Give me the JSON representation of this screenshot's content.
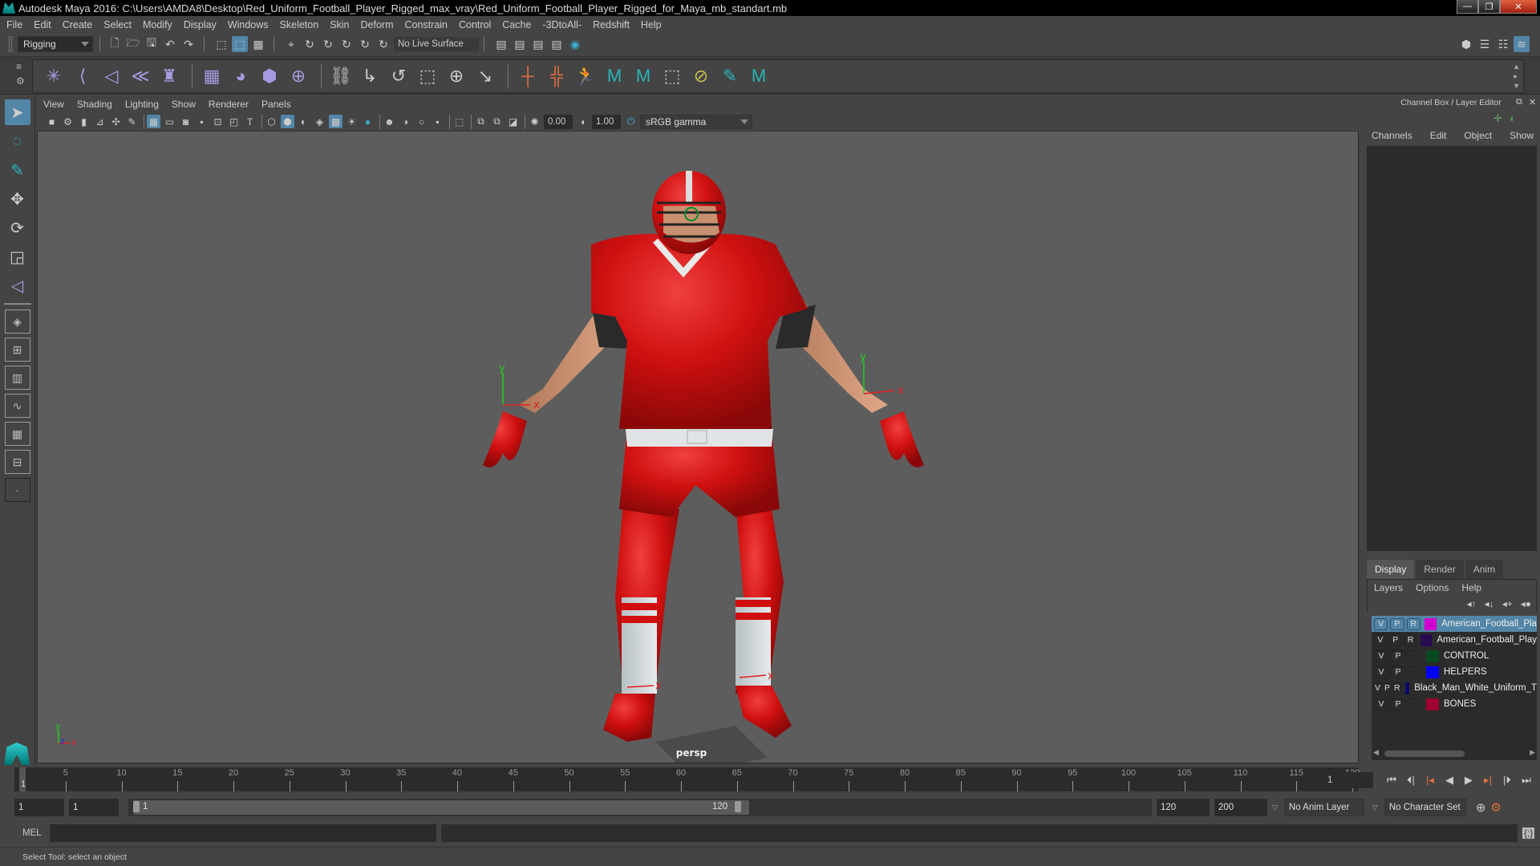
{
  "window": {
    "title": "Autodesk Maya 2016: C:\\Users\\AMDA8\\Desktop\\Red_Uniform_Football_Player_Rigged_max_vray\\Red_Uniform_Football_Player_Rigged_for_Maya_mb_standart.mb",
    "minimize": "—",
    "maximize": "❐",
    "close": "✕"
  },
  "menubar": [
    "File",
    "Edit",
    "Create",
    "Select",
    "Modify",
    "Display",
    "Windows",
    "Skeleton",
    "Skin",
    "Deform",
    "Constrain",
    "Control",
    "Cache",
    "-3DtoAll-",
    "Redshift",
    "Help"
  ],
  "statusline": {
    "menuset": "Rigging",
    "live_surface": "No Live Surface"
  },
  "shelf": {
    "icons": [
      {
        "name": "joint-tool-icon",
        "glyph": "✳",
        "color": "purple"
      },
      {
        "name": "ik-handle-icon",
        "glyph": "⟨",
        "color": "purple"
      },
      {
        "name": "ik-spline-icon",
        "glyph": "◁",
        "color": "purple"
      },
      {
        "name": "insert-joint-icon",
        "glyph": "≪",
        "color": "purple"
      },
      {
        "name": "humanik-icon",
        "glyph": "♜",
        "color": "purple"
      },
      {
        "name": "paint-weights-icon",
        "glyph": "▦",
        "color": "purple"
      },
      {
        "name": "bind-skin-icon",
        "glyph": "◕",
        "color": "purple"
      },
      {
        "name": "lattice-icon",
        "glyph": "⬢",
        "color": "purple"
      },
      {
        "name": "cluster-icon",
        "glyph": "⊕",
        "color": "purple"
      },
      {
        "name": "parent-constraint-icon",
        "glyph": "⛓",
        "color": "grey"
      },
      {
        "name": "point-constraint-icon",
        "glyph": "↳",
        "color": "grey"
      },
      {
        "name": "orient-constraint-icon",
        "glyph": "↺",
        "color": "grey"
      },
      {
        "name": "scale-constraint-icon",
        "glyph": "⬚",
        "color": "grey"
      },
      {
        "name": "aim-constraint-icon",
        "glyph": "⊕",
        "color": "grey"
      },
      {
        "name": "pole-vector-icon",
        "glyph": "↘",
        "color": "grey"
      },
      {
        "name": "set-key-icon",
        "glyph": "┼",
        "color": "orange"
      },
      {
        "name": "set-driven-key-icon",
        "glyph": "╬",
        "color": "orange"
      },
      {
        "name": "character-set-icon",
        "glyph": "🏃",
        "color": "orange"
      },
      {
        "name": "maya-logo-icon",
        "glyph": "M",
        "color": "teal"
      },
      {
        "name": "maya-logo-icon-2",
        "glyph": "M",
        "color": "teal"
      },
      {
        "name": "empty-slot-icon",
        "glyph": "⬚",
        "color": "grey"
      },
      {
        "name": "layers-off-icon",
        "glyph": "⊘",
        "color": "yellow"
      },
      {
        "name": "paint-select-icon",
        "glyph": "✎",
        "color": "teal"
      },
      {
        "name": "maya-logo-icon-3",
        "glyph": "M",
        "color": "teal"
      }
    ]
  },
  "panel": {
    "menus": [
      "View",
      "Shading",
      "Lighting",
      "Show",
      "Renderer",
      "Panels"
    ],
    "exposure": "0.00",
    "gamma": "1.00",
    "color_space": "sRGB gamma",
    "camera_label": "persp",
    "axis_labels": {
      "x": "x",
      "y": "y",
      "z": "z"
    }
  },
  "channel_box": {
    "title": "Channel Box / Layer Editor",
    "menus": [
      "Channels",
      "Edit",
      "Object",
      "Show"
    ]
  },
  "layer_editor": {
    "tabs": [
      "Display",
      "Render",
      "Anim"
    ],
    "active_tab": "Display",
    "menus": [
      "Layers",
      "Options",
      "Help"
    ],
    "layers": [
      {
        "v": "V",
        "p": "P",
        "r": "R",
        "color": "#d000d0",
        "name": "American_Football_Pla",
        "selected": true
      },
      {
        "v": "V",
        "p": "P",
        "r": "R",
        "color": "#2a0a50",
        "name": "American_Football_Play",
        "selected": false
      },
      {
        "v": "V",
        "p": "P",
        "r": "",
        "color": "#0a4a20",
        "name": "CONTROL",
        "selected": false
      },
      {
        "v": "V",
        "p": "P",
        "r": "",
        "color": "#0000ff",
        "name": "HELPERS",
        "selected": false
      },
      {
        "v": "V",
        "p": "P",
        "r": "R",
        "color": "#0a0a6a",
        "name": "Black_Man_White_Uniform_T",
        "selected": false
      },
      {
        "v": "V",
        "p": "P",
        "r": "",
        "color": "#a00030",
        "name": "BONES",
        "selected": false
      }
    ]
  },
  "timeline": {
    "ticks": [
      5,
      10,
      15,
      20,
      25,
      30,
      35,
      40,
      45,
      50,
      55,
      60,
      65,
      70,
      75,
      80,
      85,
      90,
      95,
      100,
      105,
      110,
      115,
      120
    ],
    "start": 1,
    "end": 120,
    "current_frame": "1",
    "current_frame_field": "1"
  },
  "range": {
    "start_field": "1",
    "playback_start": "1",
    "range_start_label": "1",
    "range_end_label": "120",
    "playback_end": "120",
    "end_field": "200",
    "anim_layer": "No Anim Layer",
    "character_set": "No Character Set"
  },
  "command": {
    "language": "MEL",
    "input": "",
    "output": ""
  },
  "status": {
    "help_line": "Select Tool: select an object"
  }
}
